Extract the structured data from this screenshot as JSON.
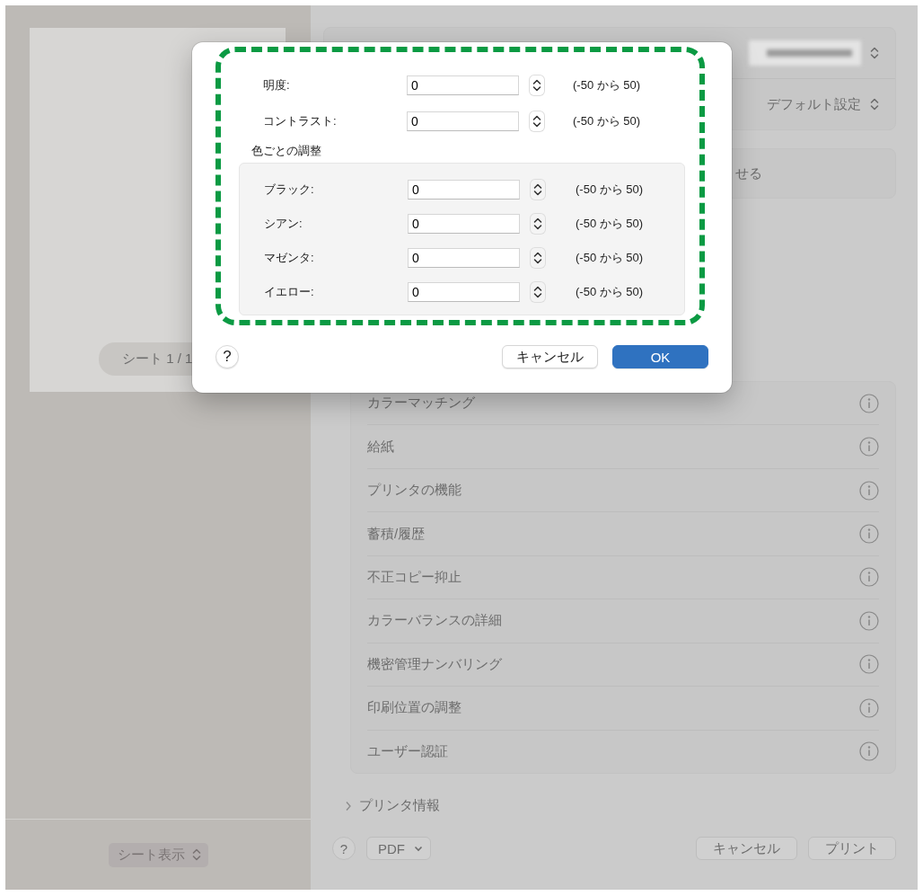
{
  "preview": {
    "sheet_label": "シート 1 / 1",
    "sheet_view_popup": "シート表示"
  },
  "printer_panel": {
    "presets": "デフォルト設定",
    "partial_option": "せる"
  },
  "settings_list": [
    {
      "label": "カラーマッチング"
    },
    {
      "label": "給紙"
    },
    {
      "label": "プリンタの機能"
    },
    {
      "label": "蓄積/履歴"
    },
    {
      "label": "不正コピー抑止"
    },
    {
      "label": "カラーバランスの詳細"
    },
    {
      "label": "機密管理ナンバリング"
    },
    {
      "label": "印刷位置の調整"
    },
    {
      "label": "ユーザー認証"
    }
  ],
  "printer_info": "プリンタ情報",
  "footer": {
    "help": "?",
    "pdf": "PDF",
    "cancel": "キャンセル",
    "print": "プリント"
  },
  "dialog": {
    "fields": [
      {
        "label": "明度:",
        "value": "0",
        "range": "(-50 から 50)"
      },
      {
        "label": "コントラスト:",
        "value": "0",
        "range": "(-50 から 50)"
      }
    ],
    "group_title": "色ごとの調整",
    "group_fields": [
      {
        "label": "ブラック:",
        "value": "0",
        "range": "(-50 から 50)"
      },
      {
        "label": "シアン:",
        "value": "0",
        "range": "(-50 から 50)"
      },
      {
        "label": "マゼンタ:",
        "value": "0",
        "range": "(-50 から 50)"
      },
      {
        "label": "イエロー:",
        "value": "0",
        "range": "(-50 から 50)"
      }
    ],
    "help": "?",
    "cancel": "キャンセル",
    "ok": "OK"
  }
}
